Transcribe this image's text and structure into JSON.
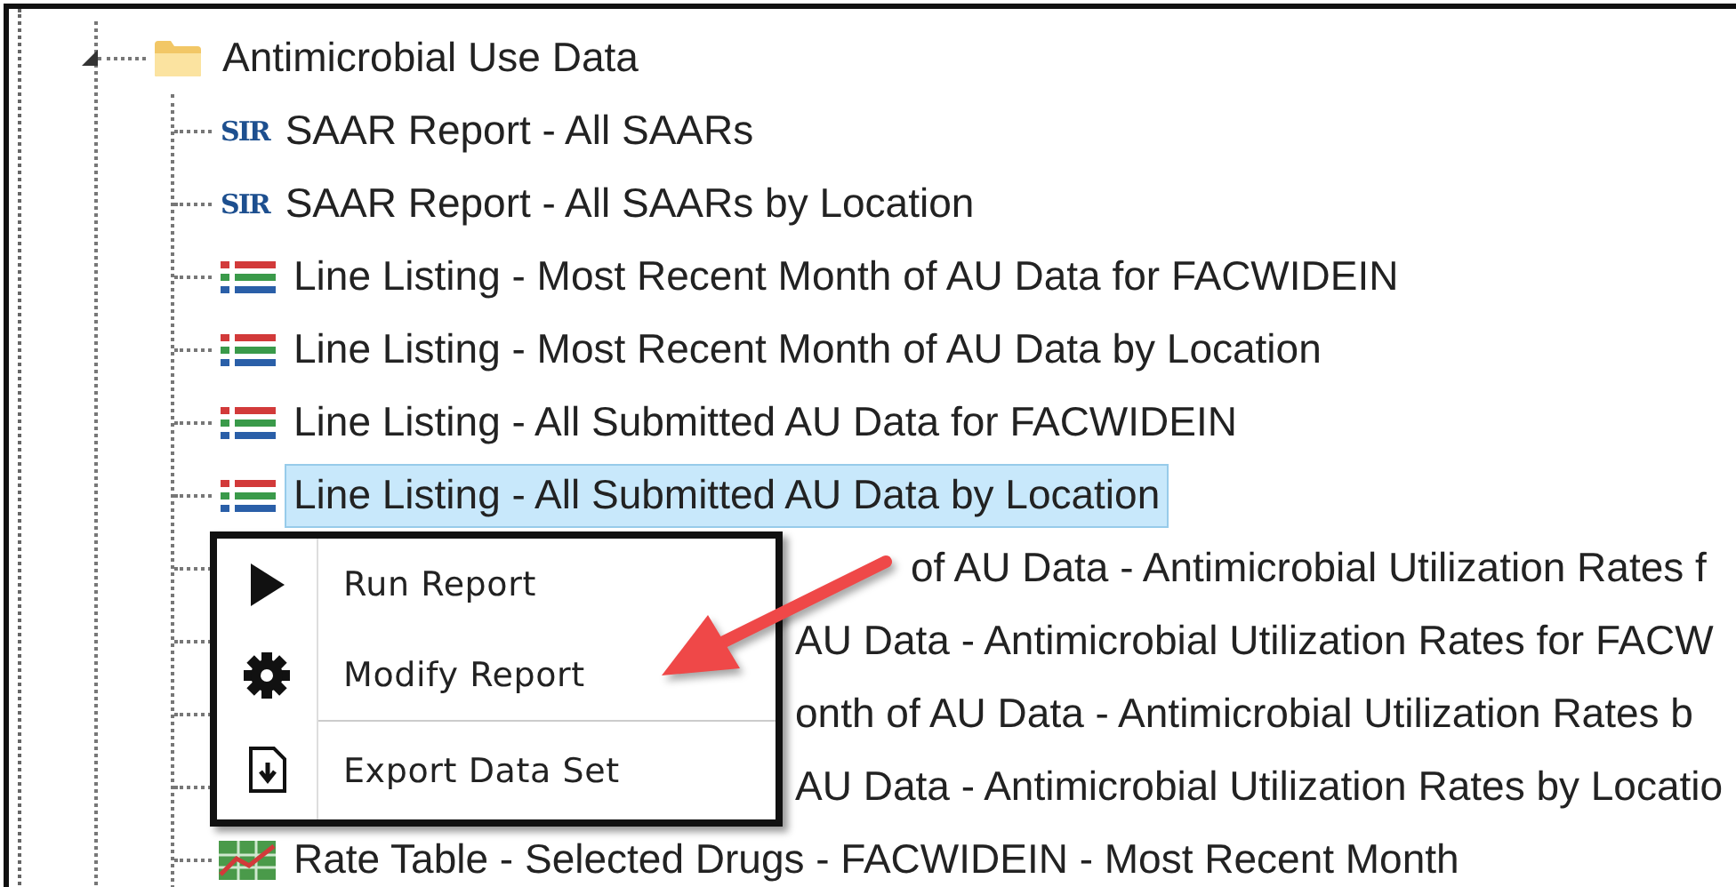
{
  "folder": {
    "label": "Antimicrobial Use Data",
    "expanded": true,
    "children": [
      {
        "kind": "sir",
        "badge": "SIR",
        "label": "SAAR Report - All SAARs",
        "selected": false
      },
      {
        "kind": "sir",
        "badge": "SIR",
        "label": "SAAR Report - All SAARs by Location",
        "selected": false
      },
      {
        "kind": "listing",
        "label": "Line Listing - Most Recent Month of AU Data for FACWIDEIN",
        "selected": false
      },
      {
        "kind": "listing",
        "label": "Line Listing - Most Recent Month of AU Data by Location",
        "selected": false
      },
      {
        "kind": "listing",
        "label": "Line Listing - All Submitted AU Data for FACWIDEIN",
        "selected": false
      },
      {
        "kind": "listing",
        "label": "Line Listing - All Submitted AU Data by Location",
        "selected": true
      },
      {
        "kind": "covered",
        "label": "of AU Data - Antimicrobial Utilization Rates f",
        "selected": false
      },
      {
        "kind": "covered",
        "label": "AU Data - Antimicrobial Utilization Rates for FACW",
        "selected": false
      },
      {
        "kind": "covered",
        "label": "onth of AU Data - Antimicrobial Utilization Rates b",
        "selected": false
      },
      {
        "kind": "covered",
        "label": "AU Data - Antimicrobial Utilization Rates by Locatio",
        "selected": false
      },
      {
        "kind": "rate_table",
        "label": "Rate Table - Selected Drugs - FACWIDEIN - Most Recent Month",
        "selected": false
      }
    ]
  },
  "context_menu": {
    "items": [
      {
        "label": "Run Report",
        "divider_before": false
      },
      {
        "label": "Modify Report",
        "divider_before": false
      },
      {
        "label": "Export Data Set",
        "divider_before": true
      }
    ]
  }
}
